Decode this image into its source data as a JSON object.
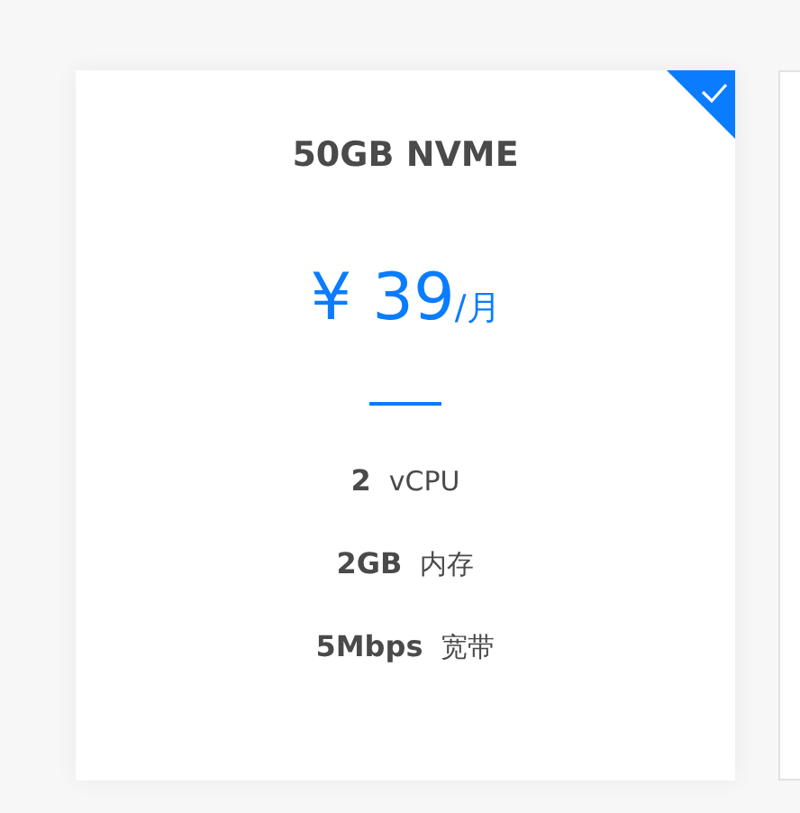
{
  "plans": [
    {
      "title": "50GB NVME",
      "selected": true,
      "price": "¥ 39",
      "unit": "/月",
      "specs": [
        {
          "value": "2",
          "label": "vCPU"
        },
        {
          "value": "2GB",
          "label": "内存"
        },
        {
          "value": "5Mbps",
          "label": "宽带"
        }
      ]
    },
    {
      "selected": false
    }
  ]
}
